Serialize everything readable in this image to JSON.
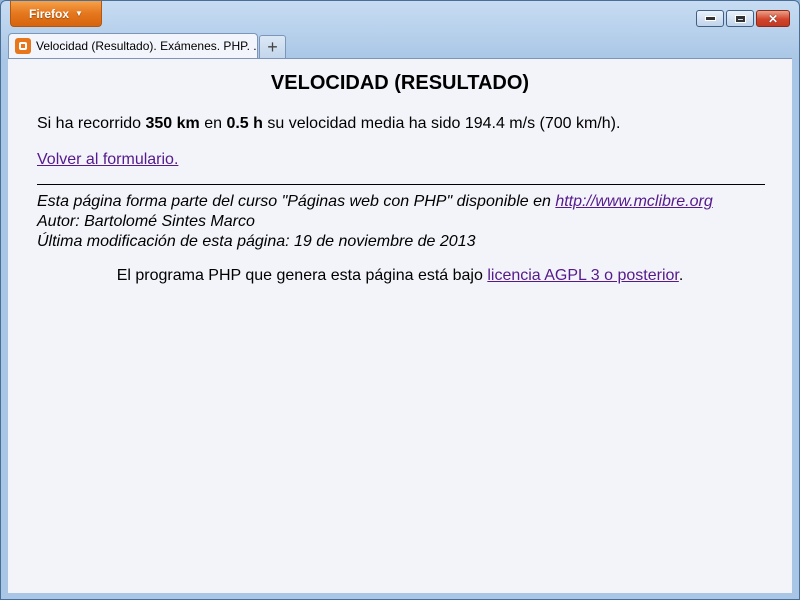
{
  "browser": {
    "menu_button_label": "Firefox",
    "tab_title": "Velocidad (Resultado). Exámenes. PHP. ...",
    "new_tab_symbol": "+"
  },
  "page": {
    "heading": "VELOCIDAD (RESULTADO)",
    "result": {
      "prefix": "Si ha recorrido ",
      "distance": "350 km",
      "middle": " en ",
      "time": "0.5 h",
      "suffix": " su velocidad media ha sido 194.4 m/s (700 km/h)."
    },
    "back_link": "Volver al formulario.",
    "footer": {
      "line1_prefix": "Esta página forma parte del curso \"Páginas web con PHP\" disponible en ",
      "line1_link": "http://www.mclibre.org",
      "author": "Autor: Bartolomé Sintes Marco",
      "modified": "Última modificación de esta página: 19 de noviembre de 2013"
    },
    "license": {
      "prefix": "El programa PHP que genera esta página está bajo ",
      "link": "licencia AGPL 3 o posterior",
      "suffix": "."
    }
  },
  "colors": {
    "firefox_button": "#e5771d",
    "visited_link": "#551a8b",
    "page_background": "#f3f4fa"
  }
}
